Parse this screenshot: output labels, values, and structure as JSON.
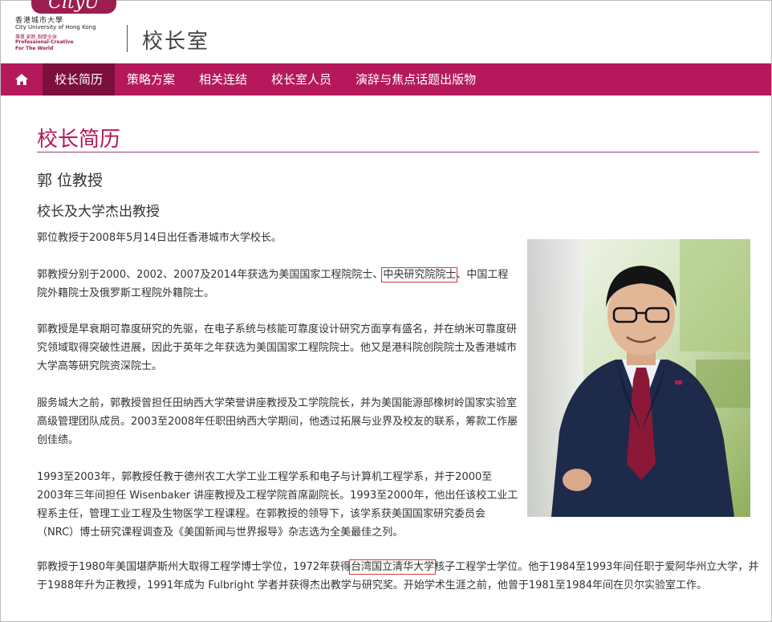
{
  "header": {
    "logo_badge": "CityU",
    "logo_zh": "香港城市大學",
    "logo_en": "City University of Hong Kong",
    "logo_tag_zh": "專業 創新 胸懷全球",
    "logo_tag_en1": "Professional·Creative",
    "logo_tag_en2": "For The World",
    "site_title": "校长室"
  },
  "nav": {
    "home_icon": "home-icon",
    "items": [
      {
        "label": "校长简历",
        "active": true
      },
      {
        "label": "策略方案"
      },
      {
        "label": "相关连结"
      },
      {
        "label": "校长室人员"
      },
      {
        "label": "演辞与焦点话题出版物"
      }
    ]
  },
  "main": {
    "page_title": "校长简历",
    "name": "郭 位教授",
    "role": "校长及大学杰出教授",
    "p1": "郭位教授于2008年5月14日出任香港城市大学校长。",
    "p2a": "郭教授分别于2000、2002、2007及2014年获选为美国国家工程院院士、",
    "p2_hl": "中央研究院院士",
    "p2b": "、中国工程院外籍院士及俄罗斯工程院外籍院士。",
    "p3": "郭教授是早衰期可靠度研究的先驱，在电子系统与核能可靠度设计研究方面享有盛名，并在纳米可靠度研究领域取得突破性进展，因此于英年之年获选为美国国家工程院院士。他又是港科院创院院士及香港城市大学高等研究院资深院士。",
    "p4": "服务城大之前，郭教授曾担任田纳西大学荣誉讲座教授及工学院院长，并为美国能源部橡树岭国家实验室高级管理团队成员。2003至2008年任职田纳西大学期间，他透过拓展与业界及校友的联系，筹款工作屡创佳绩。",
    "p5": "1993至2003年，郭教授任教于德州农工大学工业工程学系和电子与计算机工程学系，并于2000至2003年三年间担任 Wisenbaker 讲座教授及工程学院首席副院长。1993至2000年，他出任该校工业工程系主任，管理工业工程及生物医学工程课程。在郭教授的领导下，该学系获美国国家研究委员会（NRC）博士研究课程调查及《美国新闻与世界报导》杂志选为全美最佳之列。",
    "p6a": "郭教授于1980年美国堪萨斯州大取得工程学博士学位，1972年获得",
    "p6_hl": "台湾国立清华大学",
    "p6b": "核子工程学士学位。他于1984至1993年间任职于爱阿华州立大学，并于1988年升为正教授，1991年成为 Fulbright 学者并获得杰出教学与研究奖。开始学术生涯之前，他曾于1981至1984年间在贝尔实验室工作。"
  },
  "colors": {
    "brand": "#b5195b",
    "nav_active": "#7c0f3c",
    "highlight": "#d23a3a"
  }
}
